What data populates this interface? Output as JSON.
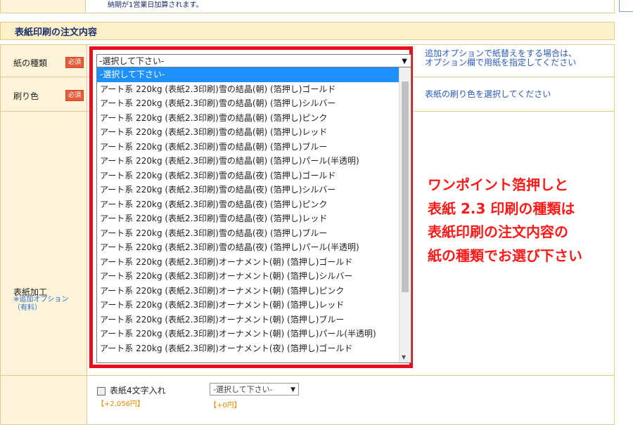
{
  "top_note": "納期が1営業日加算されます。",
  "section_title": "表紙印刷の注文内容",
  "rows": {
    "paper": {
      "label": "紙の種類",
      "required": "必須",
      "help": "追加オプションで紙替えをする場合は、\nオプション欄で用紙を指定してください"
    },
    "color": {
      "label": "刷り色",
      "required": "必須",
      "help": "表紙の刷り色を選択してください"
    },
    "cover": {
      "label": "表紙加工",
      "sub": "※追加オプション\n（有料）"
    }
  },
  "dropdown": {
    "selected": "-選択して下さい-",
    "options": [
      "-選択して下さい-",
      "アート系 220kg (表紙2.3印刷)雪の結晶(朝) (箔押し)ゴールド",
      "アート系 220kg (表紙2.3印刷)雪の結晶(朝) (箔押し)シルバー",
      "アート系 220kg (表紙2.3印刷)雪の結晶(朝) (箔押し)ピンク",
      "アート系 220kg (表紙2.3印刷)雪の結晶(朝) (箔押し)レッド",
      "アート系 220kg (表紙2.3印刷)雪の結晶(朝) (箔押し)ブルー",
      "アート系 220kg (表紙2.3印刷)雪の結晶(朝) (箔押し)パール(半透明)",
      "アート系 220kg (表紙2.3印刷)雪の結晶(夜) (箔押し)ゴールド",
      "アート系 220kg (表紙2.3印刷)雪の結晶(夜) (箔押し)シルバー",
      "アート系 220kg (表紙2.3印刷)雪の結晶(夜) (箔押し)ピンク",
      "アート系 220kg (表紙2.3印刷)雪の結晶(夜) (箔押し)レッド",
      "アート系 220kg (表紙2.3印刷)雪の結晶(夜) (箔押し)ブルー",
      "アート系 220kg (表紙2.3印刷)雪の結晶(夜) (箔押し)パール(半透明)",
      "アート系 220kg (表紙2.3印刷)オーナメント(朝) (箔押し)ゴールド",
      "アート系 220kg (表紙2.3印刷)オーナメント(朝) (箔押し)シルバー",
      "アート系 220kg (表紙2.3印刷)オーナメント(朝) (箔押し)ピンク",
      "アート系 220kg (表紙2.3印刷)オーナメント(朝) (箔押し)レッド",
      "アート系 220kg (表紙2.3印刷)オーナメント(朝) (箔押し)ブルー",
      "アート系 220kg (表紙2.3印刷)オーナメント(朝) (箔押し)パール(半透明)",
      "アート系 220kg (表紙2.3印刷)オーナメント(夜) (箔押し)ゴールド"
    ]
  },
  "annotation": [
    "ワンポイント箔押しと",
    "表紙 2.3 印刷の種類は",
    "表紙印刷の注文内容の",
    "紙の種類でお選び下さい"
  ],
  "option_row": {
    "checkbox_label": "表紙4文字入れ",
    "checkbox_price": "【+2,056円】",
    "select_value": "-選択して下さい-",
    "select_price": "【+0円】"
  },
  "colors": {
    "highlight": "#e8101a",
    "annotation": "#ff1a1a",
    "selected_option": "#1e90ff"
  }
}
